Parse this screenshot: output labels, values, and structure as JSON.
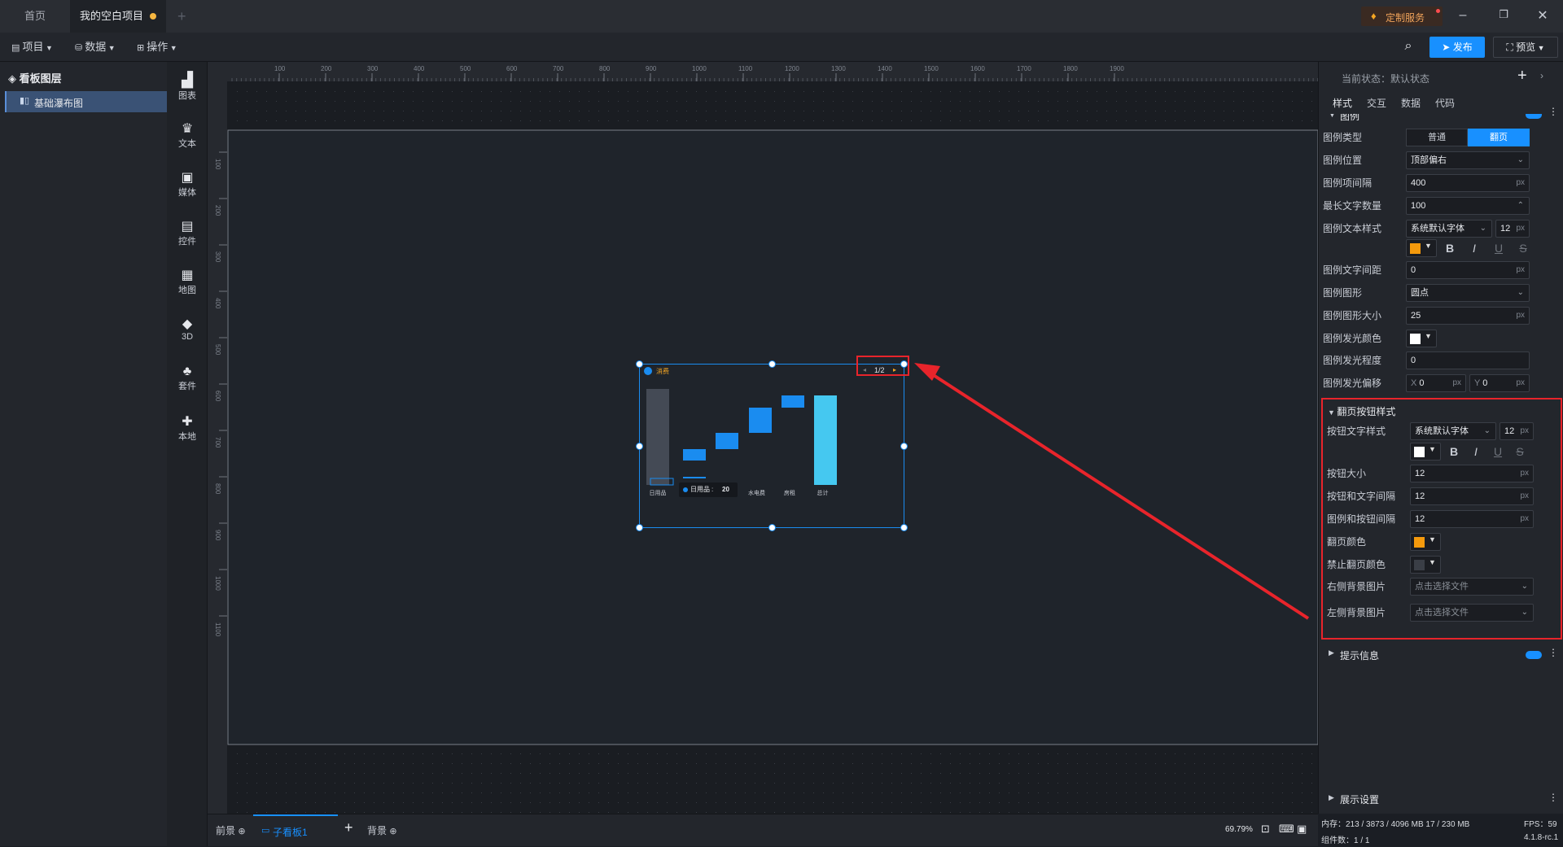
{
  "tabs": {
    "home": "首页",
    "project": "我的空白项目"
  },
  "titlebar": {
    "custom_service": "定制服务"
  },
  "toolbar": {
    "project": "项目",
    "data": "数据",
    "operate": "操作",
    "publish": "发布",
    "preview": "预览"
  },
  "layers": {
    "header": "看板图层",
    "item": "基础瀑布图"
  },
  "components": [
    "图表",
    "文本",
    "媒体",
    "控件",
    "地图",
    "3D",
    "套件",
    "本地"
  ],
  "ruler": {
    "h_ticks": [
      "100",
      "200",
      "300",
      "400",
      "500",
      "600",
      "700",
      "800",
      "900",
      "1000",
      "1100",
      "1200",
      "1300",
      "1400",
      "1500",
      "1600",
      "1700",
      "1800",
      "1900"
    ],
    "v_ticks": [
      "100",
      "200",
      "300",
      "400",
      "500",
      "600",
      "700",
      "800",
      "900",
      "1000",
      "1100"
    ]
  },
  "widget": {
    "legend_label": "消费",
    "pager": "1/2",
    "tooltip_label": "日用品",
    "tooltip_value": "20",
    "categories": [
      "日用品",
      "伙食费",
      "交通费",
      "水电费",
      "房租",
      "总计"
    ]
  },
  "right": {
    "state_label": "当前状态：",
    "state_value": "默认状态",
    "tabs": [
      "样式",
      "交互",
      "数据",
      "代码"
    ],
    "section_legend": "图例",
    "legend_type_label": "图例类型",
    "legend_type_opts": [
      "普通",
      "翻页"
    ],
    "legend_pos_label": "图例位置",
    "legend_pos_value": "顶部偏右",
    "item_gap_label": "图例项间隔",
    "item_gap_value": "400",
    "max_text_label": "最长文字数量",
    "max_text_value": "100",
    "text_style_label": "图例文本样式",
    "font_value": "系统默认字体",
    "font_size": "12",
    "text_gap_label": "图例文字间距",
    "text_gap_value": "0",
    "shape_label": "图例图形",
    "shape_value": "圆点",
    "shape_size_label": "图例图形大小",
    "shape_size_value": "25",
    "glow_color_label": "图例发光颜色",
    "glow_level_label": "图例发光程度",
    "glow_level_value": "0",
    "glow_offset_label": "图例发光偏移",
    "glow_x_label": "X",
    "glow_x_value": "0",
    "glow_y_label": "Y",
    "glow_y_value": "0",
    "unit_px": "px",
    "fmt_bold": "B",
    "fmt_italic": "I",
    "fmt_underline": "U",
    "fmt_strike": "S",
    "page_section": "翻页按钮样式",
    "btn_text_label": "按钮文字样式",
    "btn_size_label": "按钮大小",
    "btn_size_value": "12",
    "btn_text_gap_label": "按钮和文字间隔",
    "btn_text_gap_value": "12",
    "legend_btn_gap_label": "图例和按钮间隔",
    "legend_btn_gap_value": "12",
    "page_color_label": "翻页颜色",
    "disabled_color_label": "禁止翻页颜色",
    "right_bg_label": "右侧背景图片",
    "left_bg_label": "左侧背景图片",
    "file_placeholder": "点击选择文件",
    "tooltip_section": "提示信息",
    "display_section": "展示设置"
  },
  "colors": {
    "accent": "#1890ff",
    "orange": "#f59a0c",
    "highlight": "#e8242b",
    "bar_blue": "#1a8cf0",
    "bar_cyan": "#45c8f0",
    "bar_gray": "#444a55"
  },
  "status": {
    "foreground": "前景",
    "subboard": "子看板1",
    "background": "背景",
    "zoom": "69.79%",
    "memory": "内存：213 / 3873 / 4096 MB  17 / 230 MB",
    "fps": "FPS：59",
    "components": "组件数：1 / 1",
    "version": "4.1.8-rc.1"
  }
}
